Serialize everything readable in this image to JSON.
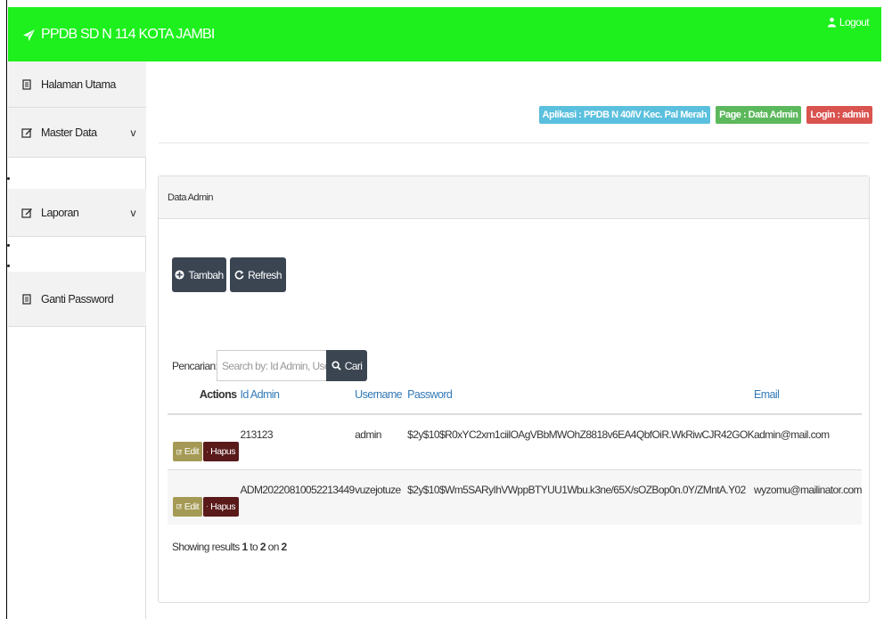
{
  "header": {
    "brand": "PPDB SD N 114 KOTA JAMBI",
    "logout_label": "Logout"
  },
  "sidebar": {
    "items": [
      {
        "label": "Halaman Utama"
      },
      {
        "label": "Master Data",
        "chevron": "v"
      },
      {
        "label": "Laporan",
        "chevron": "v"
      },
      {
        "label": "Ganti Password"
      }
    ]
  },
  "badges": {
    "app": "Aplikasi : PPDB N 40/IV Kec. Pal Merah",
    "page": "Page : Data Admin",
    "login": "Login : admin"
  },
  "panel": {
    "title": "Data Admin",
    "add_label": "Tambah",
    "refresh_label": "Refresh",
    "search_label": "Pencarian:",
    "search_placeholder": "Search by: Id Admin, Username",
    "search_button": "Cari"
  },
  "table": {
    "columns": [
      "Actions",
      "Id Admin",
      "Username",
      "Password",
      "Email"
    ],
    "edit_label": "Edit",
    "delete_label": "Hapus",
    "rows": [
      {
        "id": "213123",
        "username": "admin",
        "password": "$2y$10$R0xYC2xm1ciilOAgVBbMWOhZ8818v6EA4QbfOiR.WkRiwCJR42GOK",
        "email": "admin@mail.com"
      },
      {
        "id": "ADM20220810052213449",
        "username": "vuzejotuze",
        "password": "$2y$10$Wm5SARyIhVWppBTYUU1Wbu.k3ne/65X/sOZBop0n.0Y/ZMntA.Y02",
        "email": "wyzomu@mailinator.com"
      }
    ]
  },
  "results": {
    "prefix": "Showing results",
    "from": "1",
    "to_word": "to",
    "to": "2",
    "on_word": "on",
    "total": "2"
  },
  "colors": {
    "topbar": "#1df01d",
    "badge_info": "#5bc0de",
    "badge_success": "#5cb85c",
    "badge_danger": "#d9534f",
    "button_dark": "#3b4552",
    "edit": "#a59a55",
    "delete": "#5a1a1a"
  }
}
